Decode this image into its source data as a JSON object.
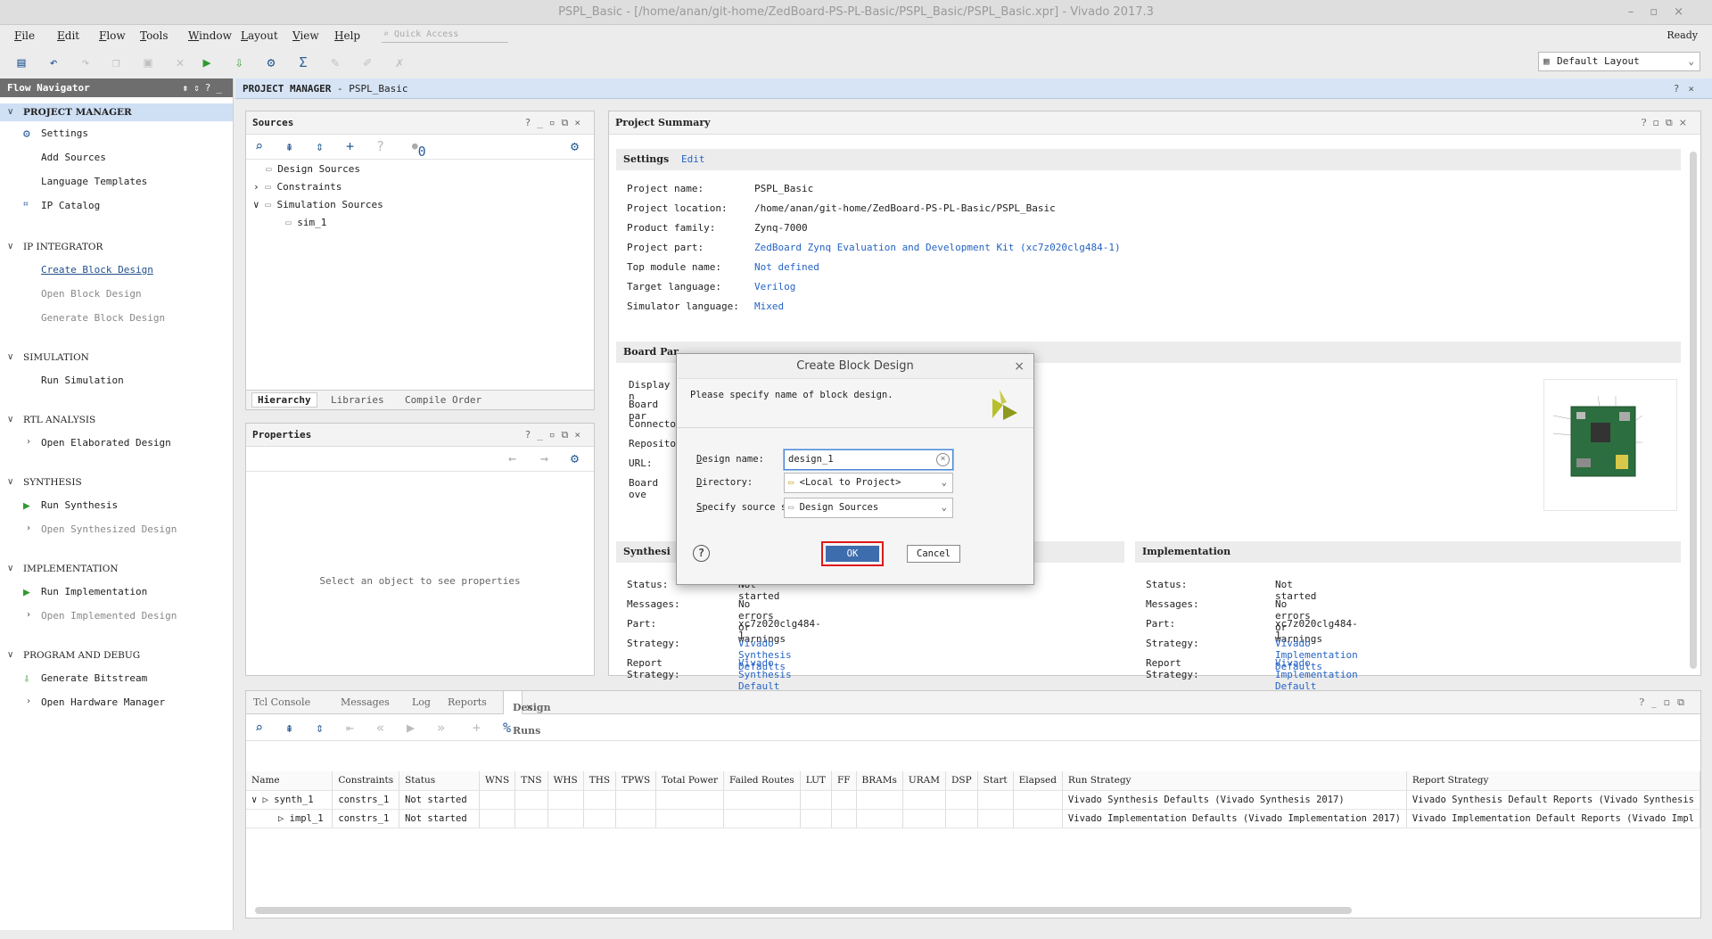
{
  "window": {
    "title": "PSPL_Basic - [/home/anan/git-home/ZedBoard-PS-PL-Basic/PSPL_Basic/PSPL_Basic.xpr] - Vivado 2017.3",
    "controls": "–▫×"
  },
  "menu": [
    "File",
    "Edit",
    "Flow",
    "Tools",
    "Window",
    "Layout",
    "View",
    "Help"
  ],
  "quick_access": "Quick Access",
  "status": "Ready",
  "layout_selector": "Default Layout",
  "flow_navigator": {
    "title": "Flow Navigator",
    "items": [
      {
        "label": "PROJECT MANAGER",
        "kind": "section"
      },
      {
        "label": "Settings"
      },
      {
        "label": "Add Sources"
      },
      {
        "label": "Language Templates"
      },
      {
        "label": "IP Catalog"
      },
      {
        "label": "IP INTEGRATOR",
        "kind": "section"
      },
      {
        "label": "Create Block Design"
      },
      {
        "label": "Open Block Design"
      },
      {
        "label": "Generate Block Design"
      },
      {
        "label": "SIMULATION",
        "kind": "section"
      },
      {
        "label": "Run Simulation"
      },
      {
        "label": "RTL ANALYSIS",
        "kind": "section"
      },
      {
        "label": "Open Elaborated Design"
      },
      {
        "label": "SYNTHESIS",
        "kind": "section"
      },
      {
        "label": "Run Synthesis"
      },
      {
        "label": "Open Synthesized Design"
      },
      {
        "label": "IMPLEMENTATION",
        "kind": "section"
      },
      {
        "label": "Run Implementation"
      },
      {
        "label": "Open Implemented Design"
      },
      {
        "label": "PROGRAM AND DEBUG",
        "kind": "section"
      },
      {
        "label": "Generate Bitstream"
      },
      {
        "label": "Open Hardware Manager"
      }
    ]
  },
  "project_manager_bar": {
    "title": "PROJECT MANAGER",
    "project": " - PSPL_Basic"
  },
  "sources": {
    "title": "Sources",
    "badge": "0",
    "tree": [
      "Design Sources",
      "Constraints",
      "Simulation Sources",
      "sim_1"
    ],
    "tabs": [
      "Hierarchy",
      "Libraries",
      "Compile Order"
    ]
  },
  "properties": {
    "title": "Properties",
    "empty": "Select an object to see properties"
  },
  "summary": {
    "title": "Project Summary",
    "settings_label": "Settings",
    "edit": "Edit",
    "rows": [
      {
        "k": "Project name:",
        "v": "PSPL_Basic"
      },
      {
        "k": "Project location:",
        "v": "/home/anan/git-home/ZedBoard-PS-PL-Basic/PSPL_Basic"
      },
      {
        "k": "Product family:",
        "v": "Zynq-7000"
      },
      {
        "k": "Project part:",
        "v": "ZedBoard Zynq Evaluation and Development Kit (xc7z020clg484-1)"
      },
      {
        "k": "Top module name:",
        "v": "Not defined"
      },
      {
        "k": "Target language:",
        "v": "Verilog"
      },
      {
        "k": "Simulator language:",
        "v": "Mixed"
      }
    ],
    "board_part_label": "Board Par",
    "board_rows": [
      "Display n",
      "Board par",
      "Connector",
      "Repositor",
      "URL:",
      "Board ove"
    ],
    "synthesis_label": "Synthesi",
    "synth_rows": [
      {
        "k": "Status:",
        "v": "Not started"
      },
      {
        "k": "Messages:",
        "v": "No errors or warnings"
      },
      {
        "k": "Part:",
        "v": "xc7z020clg484-1"
      },
      {
        "k": "Strategy:",
        "v": "Vivado Synthesis Defaults"
      },
      {
        "k": "Report Strategy:",
        "v": "Vivado Synthesis Default Reports"
      }
    ],
    "implementation_label": "Implementation",
    "impl_rows": [
      {
        "k": "Status:",
        "v": "Not started"
      },
      {
        "k": "Messages:",
        "v": "No errors or warnings"
      },
      {
        "k": "Part:",
        "v": "xc7z020clg484-1"
      },
      {
        "k": "Strategy:",
        "v": "Vivado Implementation Defaults"
      },
      {
        "k": "Report Strategy:",
        "v": "Vivado Implementation Default Reports"
      }
    ]
  },
  "console": {
    "tabs": [
      "Tcl Console",
      "Messages",
      "Log",
      "Reports",
      "Design Runs"
    ],
    "columns": [
      "Name",
      "Constraints",
      "Status",
      "WNS",
      "TNS",
      "WHS",
      "THS",
      "TPWS",
      "Total Power",
      "Failed Routes",
      "LUT",
      "FF",
      "BRAMs",
      "URAM",
      "DSP",
      "Start",
      "Elapsed",
      "Run Strategy",
      "Report Strategy"
    ],
    "rows": [
      {
        "name": "synth_1",
        "constraints": "constrs_1",
        "status": "Not started",
        "run_strategy": "Vivado Synthesis Defaults (Vivado Synthesis 2017)",
        "report_strategy": "Vivado Synthesis Default Reports (Vivado Synthesis"
      },
      {
        "name": "impl_1",
        "constraints": "constrs_1",
        "status": "Not started",
        "run_strategy": "Vivado Implementation Defaults (Vivado Implementation 2017)",
        "report_strategy": "Vivado Implementation Default Reports (Vivado Impl"
      }
    ]
  },
  "dialog": {
    "title": "Create Block Design",
    "message": "Please specify name of block design.",
    "design_name_label": "Design name:",
    "design_name_value": "design_1",
    "directory_label": "Directory:",
    "directory_value": "<Local to Project>",
    "source_set_label": "Specify source set:",
    "source_set_value": "Design Sources",
    "ok": "OK",
    "cancel": "Cancel"
  }
}
